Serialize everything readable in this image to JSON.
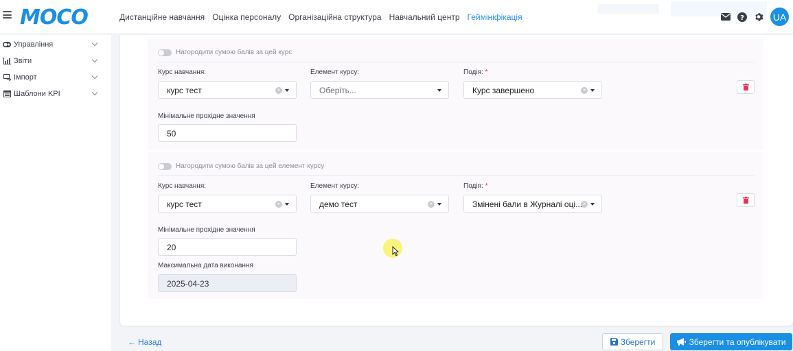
{
  "header": {
    "logo": "MOCO",
    "nav": [
      {
        "label": "Дистанційне навчання",
        "active": false
      },
      {
        "label": "Оцінка персоналу",
        "active": false
      },
      {
        "label": "Організаційна структура",
        "active": false
      },
      {
        "label": "Навчальний центр",
        "active": false
      },
      {
        "label": "Геймініфікація",
        "active": true
      }
    ],
    "icons": [
      "mail-icon",
      "help-icon",
      "gear-icon"
    ],
    "language": "UA",
    "accent_color": "#1a8fe3"
  },
  "sidebar": {
    "items": [
      {
        "label": "Управління",
        "icon": "toggle-icon"
      },
      {
        "label": "Звіти",
        "icon": "chart-icon"
      },
      {
        "label": "Імпорт",
        "icon": "import-icon"
      },
      {
        "label": "Шаблони KPI",
        "icon": "template-icon"
      }
    ]
  },
  "conditions": [
    {
      "toggle_label": "Нагородити сумою балів за цей курс",
      "course_label": "Курс навчання:",
      "course_value": "курс тест",
      "element_label": "Елемент курсу:",
      "element_value": "",
      "element_placeholder": "Оберіть...",
      "event_label": "Подія:",
      "event_required": "*",
      "event_value": "Курс завершено",
      "min_label": "Мінімальне прохідне значення",
      "min_value": "50"
    },
    {
      "toggle_label": "Нагородити сумою балів за цей елемент курсу",
      "course_label": "Курс навчання:",
      "course_value": "курс тест",
      "element_label": "Елемент курсу:",
      "element_value": "демо тест",
      "event_label": "Подія:",
      "event_required": "*",
      "event_value": "Змінені бали в Журналі оці...",
      "min_label": "Мінімальне прохідне значення",
      "min_value": "20",
      "max_date_label": "Максимальна дата виконання",
      "max_date_value": "2025-04-23"
    }
  ],
  "footer": {
    "back_label": "Назад",
    "save_label": "Зберегти",
    "publish_label": "Зберегти та опублікувати"
  }
}
